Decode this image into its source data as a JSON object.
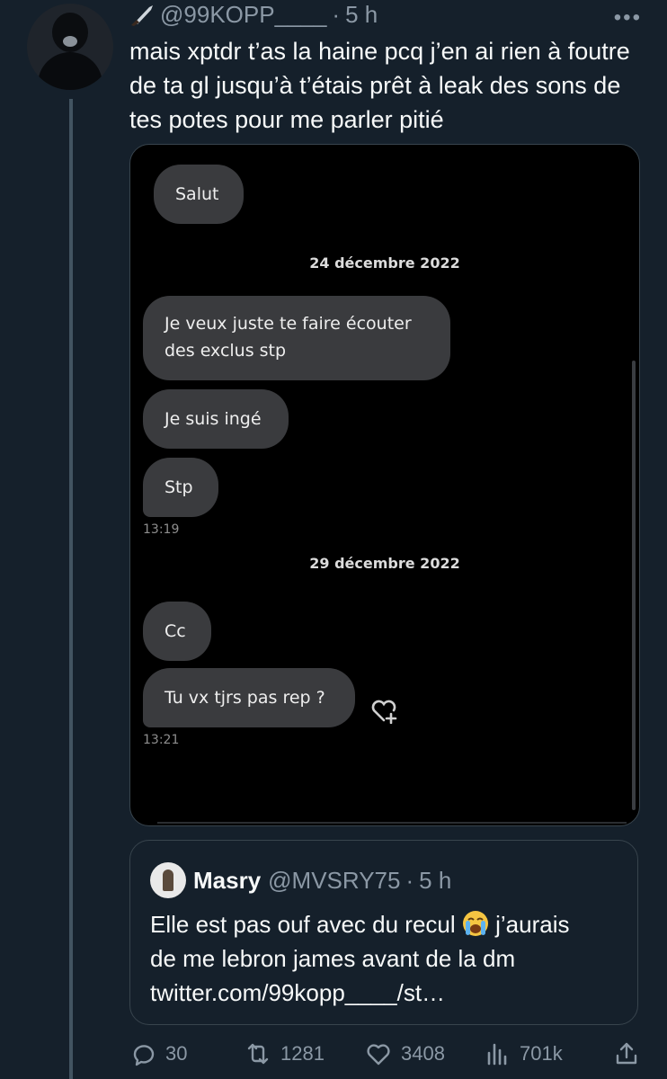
{
  "tweet": {
    "handle": "@99KOPP____",
    "separator": "·",
    "time": "5 h",
    "more": "•••",
    "text": "mais xptdr t’as la haine pcq j’en ai rien à foutre de ta gl jusqu’à t’étais prêt à leak des sons de tes potes pour me parler pitié"
  },
  "screenshot": {
    "messages": [
      "Salut",
      "Je veux juste te faire écouter",
      "des exclus stp",
      "Je suis ingé",
      "Stp",
      "Cc",
      "Tu vx tjrs pas rep ?"
    ],
    "dates": [
      "24 décembre 2022",
      "29 décembre 2022"
    ],
    "timestamps": [
      "13:19",
      "13:21"
    ]
  },
  "quote": {
    "name": "Masry",
    "handle": "@MVSRY75",
    "separator": "·",
    "time": "5 h",
    "line1": "Elle est pas ouf avec du recul",
    "line1_after": " j’aurais",
    "line2": "de me lebron james avant de la dm",
    "line3": "twitter.com/99kopp____/st…",
    "emoji": "loudly-crying-face"
  },
  "actions": {
    "replies": "30",
    "retweets": "1281",
    "likes": "3408",
    "views": "701k"
  },
  "colors": {
    "background": "#15202b",
    "secondary_text": "#8b98a5",
    "border": "#38444d",
    "bubble": "#3a3b3e"
  }
}
